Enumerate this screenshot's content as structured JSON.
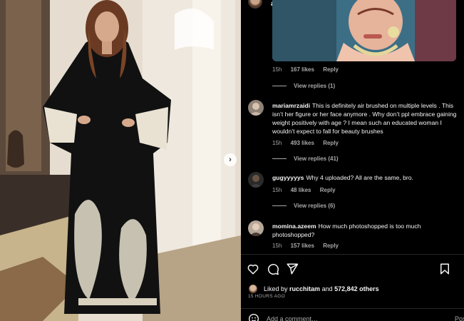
{
  "post": {
    "username": "aishwaryaraibachchan_arb",
    "verified": true
  },
  "comments": [
    {
      "meta": {
        "time": "15h",
        "likes": "167 likes",
        "reply": "Reply"
      },
      "view_replies": "View replies (1)"
    },
    {
      "username": "mariamrzaidi",
      "text": "This is definitely air brushed on multiple levels . This isn’t her figure or her face anymore . Why don’t ppl embrace gaining weight positively with age ? I mean such an educated woman I wouldn’t expect to fall for beauty brushes",
      "meta": {
        "time": "15h",
        "likes": "493 likes",
        "reply": "Reply"
      },
      "view_replies": "View replies (41)"
    },
    {
      "username": "gugyyyyys",
      "text": "Why 4 uploaded? All are the same, bro.",
      "meta": {
        "time": "15h",
        "likes": "48 likes",
        "reply": "Reply"
      },
      "view_replies": "View replies (6)"
    },
    {
      "username": "momina.azeem",
      "text": "How much photoshopped is too much photoshopped?",
      "meta": {
        "time": "15h",
        "likes": "157 likes",
        "reply": "Reply"
      }
    }
  ],
  "actions": [
    "heart-icon",
    "comment-icon",
    "share-icon",
    "bookmark-icon"
  ],
  "likes_summary": {
    "prefix": "Liked by",
    "user": "rucchitam",
    "connector": "and",
    "others": "572,842 others"
  },
  "timestamp": "15 HOURS AGO",
  "add_comment": {
    "placeholder": "Add a comment…",
    "post_label": "Post"
  },
  "colors": {
    "background": "#000000",
    "text": "#f5f5f5",
    "muted": "#a8a8a8",
    "verified": "#3897f0"
  }
}
